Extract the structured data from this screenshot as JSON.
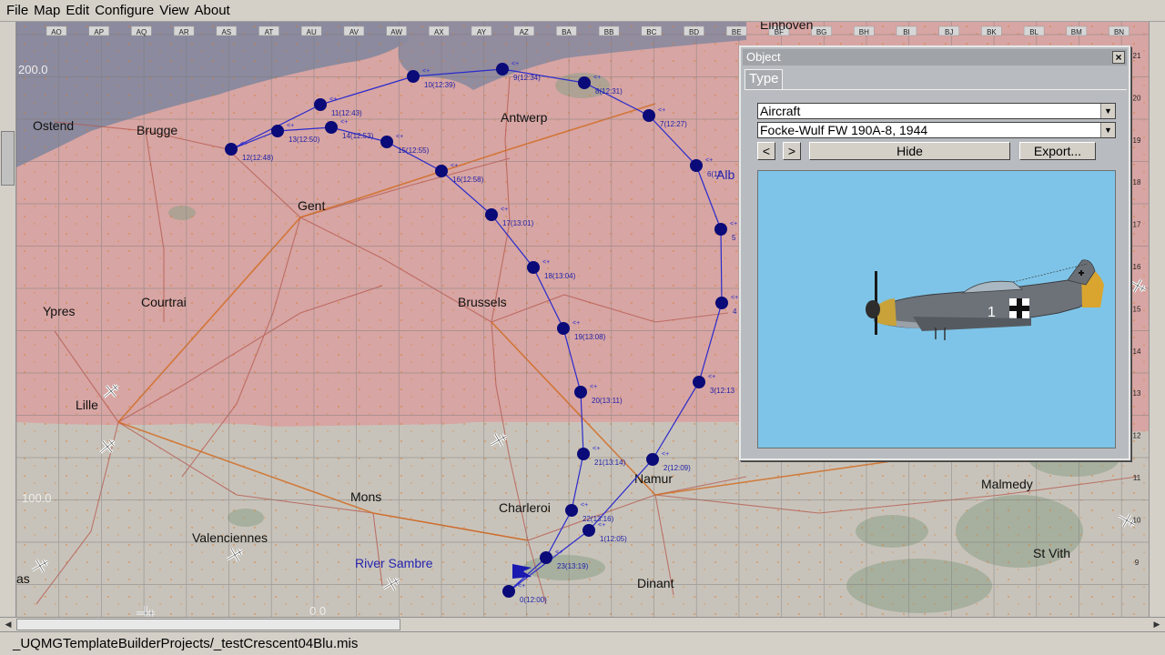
{
  "menu": [
    "File",
    "Map",
    "Edit",
    "Configure",
    "View",
    "About"
  ],
  "grid": {
    "columns": [
      "AO",
      "AP",
      "AQ",
      "AR",
      "AS",
      "AT",
      "AU",
      "AV",
      "AW",
      "AX",
      "AY",
      "AZ",
      "BA",
      "BB",
      "BC",
      "BD",
      "BE",
      "BF",
      "BG",
      "BH",
      "BI",
      "BJ",
      "BK",
      "BL",
      "BM",
      "BN"
    ],
    "rows": [
      "21",
      "20",
      "19",
      "18",
      "17",
      "16",
      "15",
      "14",
      "13",
      "12",
      "11",
      "10",
      "9"
    ],
    "altitude_labels": [
      "200.0",
      "100.0",
      "0.0"
    ]
  },
  "map": {
    "cities": [
      {
        "name": "Ostend"
      },
      {
        "name": "Brugge"
      },
      {
        "name": "Antwerp"
      },
      {
        "name": "Gent"
      },
      {
        "name": "Courtrai"
      },
      {
        "name": "Brussels"
      },
      {
        "name": "Ypres"
      },
      {
        "name": "Lille"
      },
      {
        "name": "Mons"
      },
      {
        "name": "Charleroi"
      },
      {
        "name": "Namur"
      },
      {
        "name": "Valenciennes"
      },
      {
        "name": "River Sambre"
      },
      {
        "name": "Dinant"
      },
      {
        "name": "Malmedy"
      },
      {
        "name": "St Vith"
      },
      {
        "name": "as"
      },
      {
        "name": "Alb"
      },
      {
        "name": "Einhoven"
      }
    ],
    "waypoints": [
      {
        "label": "0(12:00)"
      },
      {
        "label": "1(12:05)"
      },
      {
        "label": "2(12:09)"
      },
      {
        "label": "3(12:13"
      },
      {
        "label": "4"
      },
      {
        "label": "5"
      },
      {
        "label": "6(12"
      },
      {
        "label": "7(12:27)"
      },
      {
        "label": "8(12:31)"
      },
      {
        "label": "9(12:34)"
      },
      {
        "label": "10(12:39)"
      },
      {
        "label": "11(12:43)"
      },
      {
        "label": "12(12:48)"
      },
      {
        "label": "13(12:50)"
      },
      {
        "label": "14(12:53)"
      },
      {
        "label": "15(12:55)"
      },
      {
        "label": "16(12:58)"
      },
      {
        "label": "17(13:01)"
      },
      {
        "label": "18(13:04)"
      },
      {
        "label": "19(13:08)"
      },
      {
        "label": "20(13:11)"
      },
      {
        "label": "21(13:14)"
      },
      {
        "label": "22(13:16)"
      },
      {
        "label": "23(13:19)"
      }
    ],
    "waypoint_marker": "<+",
    "colors": {
      "route": "#2a2acc",
      "waypoint": "#0a0a78",
      "hostile_zone": "#d6a4a4",
      "friendly_zone": "#c9c4bb",
      "sea": "#8a8aa0"
    }
  },
  "panel": {
    "title": "Object",
    "close_label": "×",
    "tab": "Type",
    "category_value": "Aircraft",
    "type_value": "Focke-Wulf FW 190A-8, 1944",
    "prev_label": "<",
    "next_label": ">",
    "hide_label": "Hide",
    "export_label": "Export...",
    "aircraft_number": "1"
  },
  "status": {
    "path": "_UQMGTemplateBuilderProjects/_testCrescent04Blu.mis"
  }
}
